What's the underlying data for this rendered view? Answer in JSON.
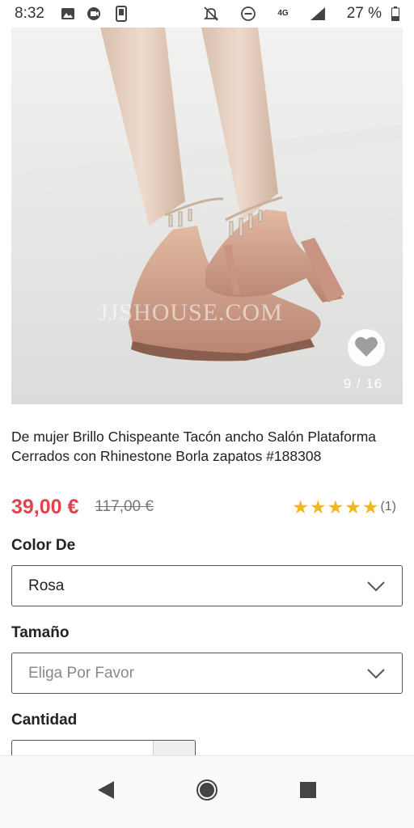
{
  "status_bar": {
    "time": "8:32",
    "network": "4G",
    "battery": "27 %",
    "icons": [
      "gallery-icon",
      "video-call-icon",
      "phone-icon",
      "mute-icon",
      "do-not-disturb-icon",
      "signal-icon",
      "battery-icon"
    ]
  },
  "product": {
    "image": {
      "counter": "9 / 16",
      "watermark": "JJSHOUSE.COM"
    },
    "title": "De mujer Brillo Chispeante Tacón ancho Salón Plataforma Cerrados con Rhinestone Borla zapatos #188308",
    "price": "39,00 €",
    "old_price": "117,00 €",
    "rating": {
      "stars": 5,
      "count": "(1)"
    }
  },
  "options": {
    "color": {
      "label": "Color De",
      "value": "Rosa"
    },
    "size": {
      "label": "Tamaño",
      "placeholder": "Eliga Por Favor"
    },
    "quantity": {
      "label": "Cantidad"
    }
  },
  "colors": {
    "price": "#e0434d",
    "star": "#f3b61f",
    "shoe": "#d7a38c"
  },
  "navigation": {
    "icons": [
      "back-icon",
      "home-icon",
      "recents-icon"
    ]
  }
}
